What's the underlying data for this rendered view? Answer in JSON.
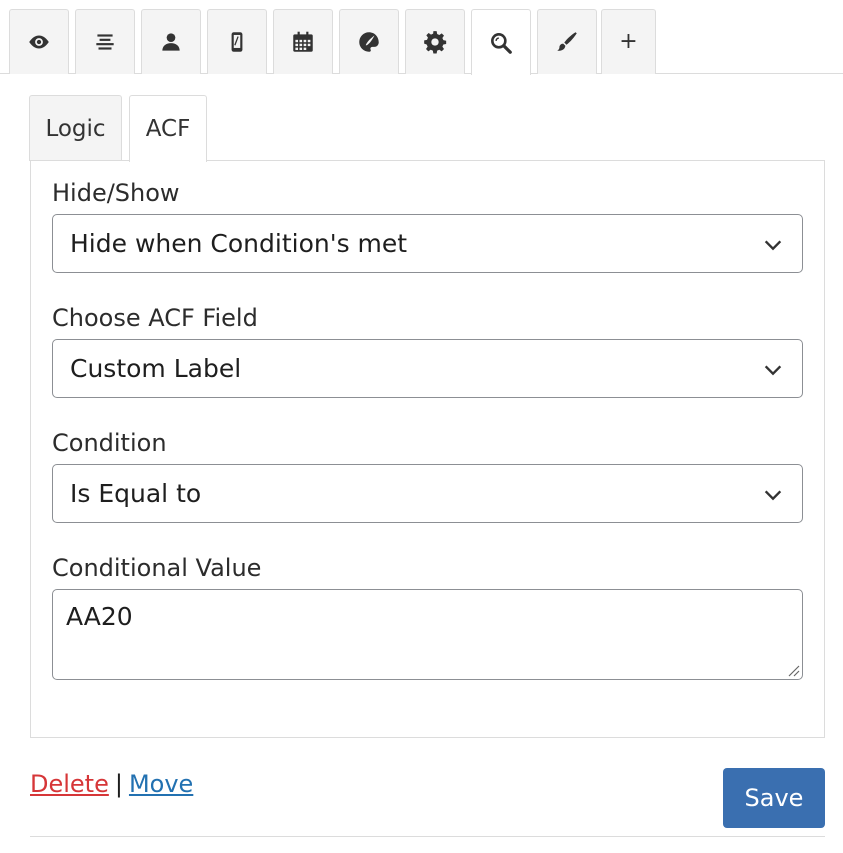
{
  "toolbar": {
    "tabs": [
      {
        "icon": "eye-icon"
      },
      {
        "icon": "align-center-icon"
      },
      {
        "icon": "user-icon"
      },
      {
        "icon": "mobile-icon"
      },
      {
        "icon": "calendar-icon"
      },
      {
        "icon": "palette-icon"
      },
      {
        "icon": "gear-icon"
      },
      {
        "icon": "search-icon",
        "active": true
      },
      {
        "icon": "brush-icon"
      },
      {
        "icon": "plus-icon",
        "label": "+"
      }
    ]
  },
  "subtabs": {
    "logic_label": "Logic",
    "acf_label": "ACF",
    "active": "ACF"
  },
  "form": {
    "hide_show": {
      "label": "Hide/Show",
      "value": "Hide when Condition's met"
    },
    "acf_field": {
      "label": "Choose ACF Field",
      "value": "Custom Label"
    },
    "condition": {
      "label": "Condition",
      "value": "Is Equal to"
    },
    "conditional_value": {
      "label": "Conditional Value",
      "value": "AA20"
    }
  },
  "footer": {
    "delete_label": "Delete",
    "separator": "|",
    "move_label": "Move",
    "save_label": "Save"
  },
  "colors": {
    "save_button": "#3a6fb0",
    "delete_link": "#d63638",
    "move_link": "#2271b1"
  }
}
